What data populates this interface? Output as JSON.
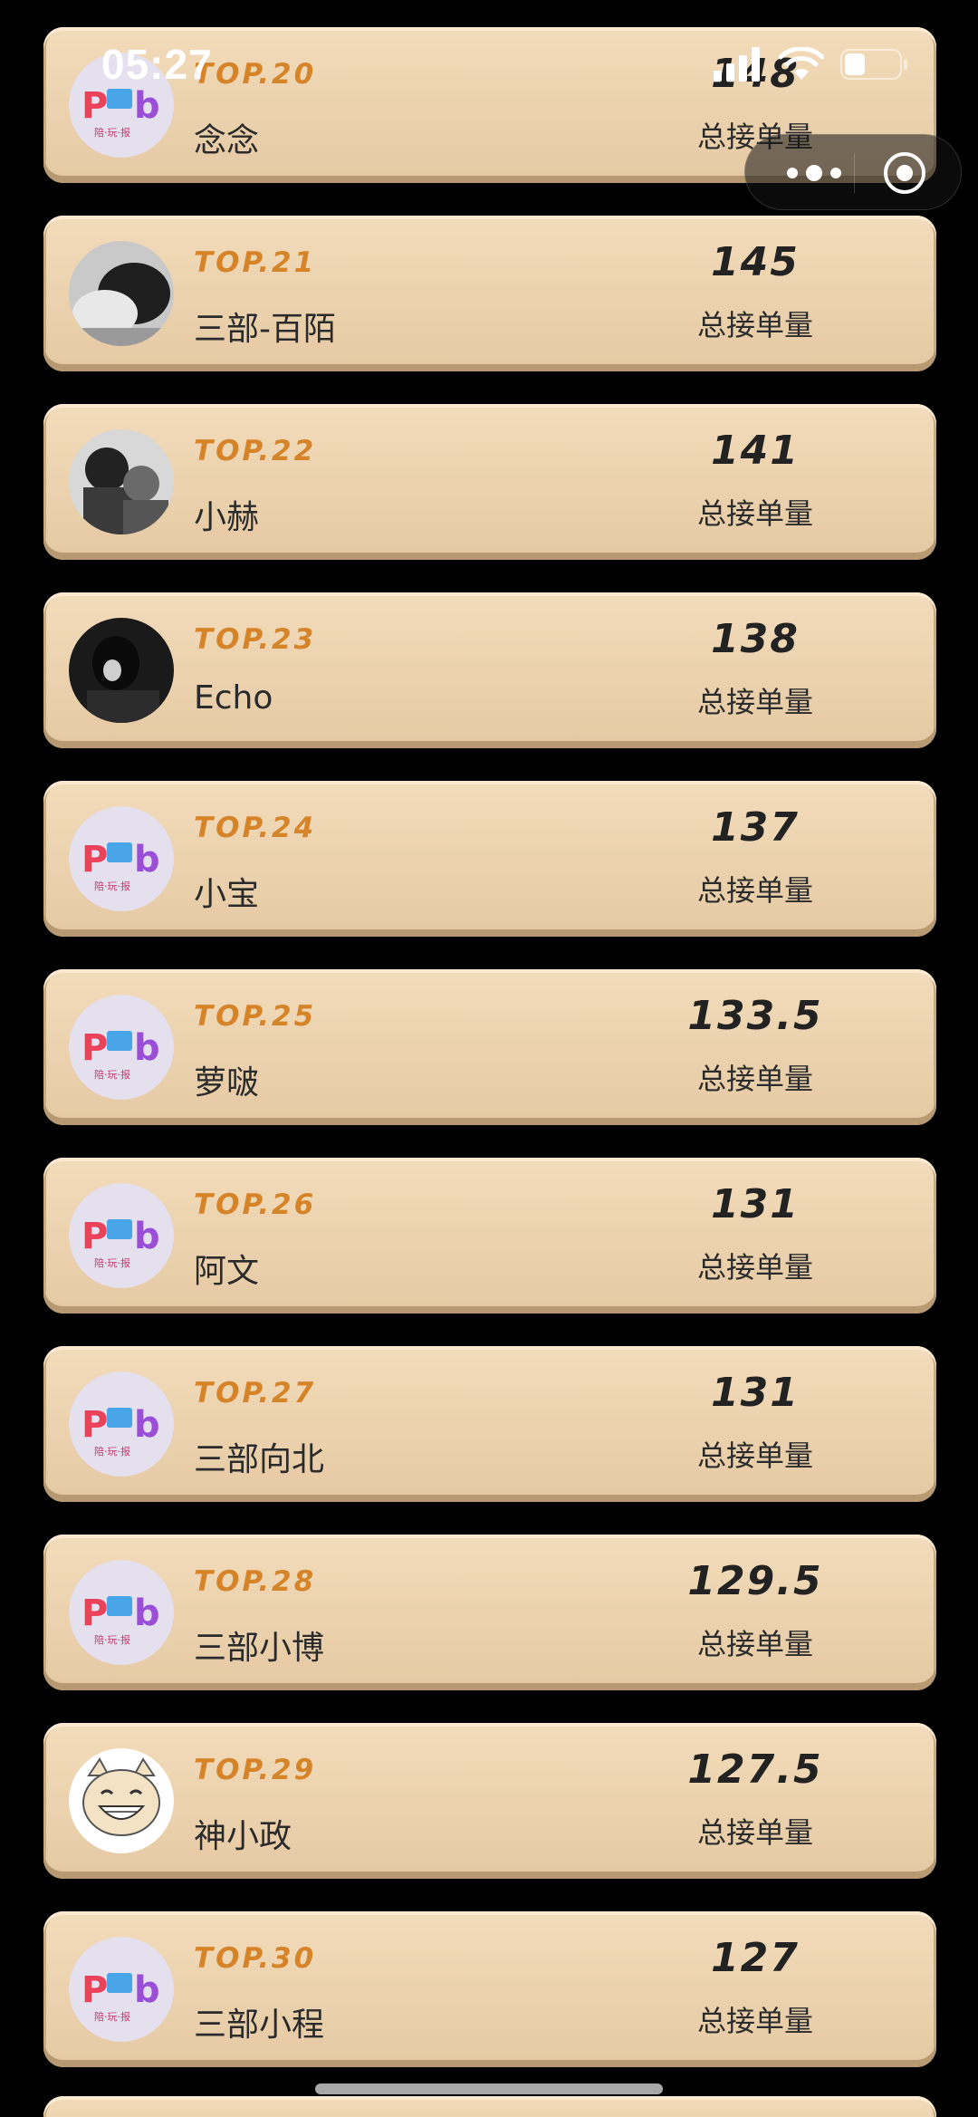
{
  "status_bar": {
    "time": "05:27",
    "icons": [
      "signal-icon",
      "wifi-icon",
      "battery-icon"
    ]
  },
  "capsule": {
    "icons": [
      "more-icon",
      "close-icon"
    ]
  },
  "list": {
    "caption": "总接单量",
    "items": [
      {
        "rank": "TOP.20",
        "name": "念念",
        "count": "148",
        "avatar": "brand-logo"
      },
      {
        "rank": "TOP.21",
        "name": "三部-百陌",
        "count": "145",
        "avatar": "photo"
      },
      {
        "rank": "TOP.22",
        "name": "小赫",
        "count": "141",
        "avatar": "photo"
      },
      {
        "rank": "TOP.23",
        "name": "Echo",
        "count": "138",
        "avatar": "photo-dark"
      },
      {
        "rank": "TOP.24",
        "name": "小宝",
        "count": "137",
        "avatar": "brand-logo"
      },
      {
        "rank": "TOP.25",
        "name": "萝啵",
        "count": "133.5",
        "avatar": "brand-logo"
      },
      {
        "rank": "TOP.26",
        "name": "阿文",
        "count": "131",
        "avatar": "brand-logo"
      },
      {
        "rank": "TOP.27",
        "name": "三部向北",
        "count": "131",
        "avatar": "brand-logo"
      },
      {
        "rank": "TOP.28",
        "name": "三部小博",
        "count": "129.5",
        "avatar": "brand-logo"
      },
      {
        "rank": "TOP.29",
        "name": "神小政",
        "count": "127.5",
        "avatar": "cartoon-cat"
      },
      {
        "rank": "TOP.30",
        "name": "三部小程",
        "count": "127",
        "avatar": "brand-logo"
      }
    ]
  },
  "colors": {
    "background": "#000000",
    "card": "#eed6b4",
    "rank": "#d6842a",
    "text": "#2b2b2b"
  }
}
